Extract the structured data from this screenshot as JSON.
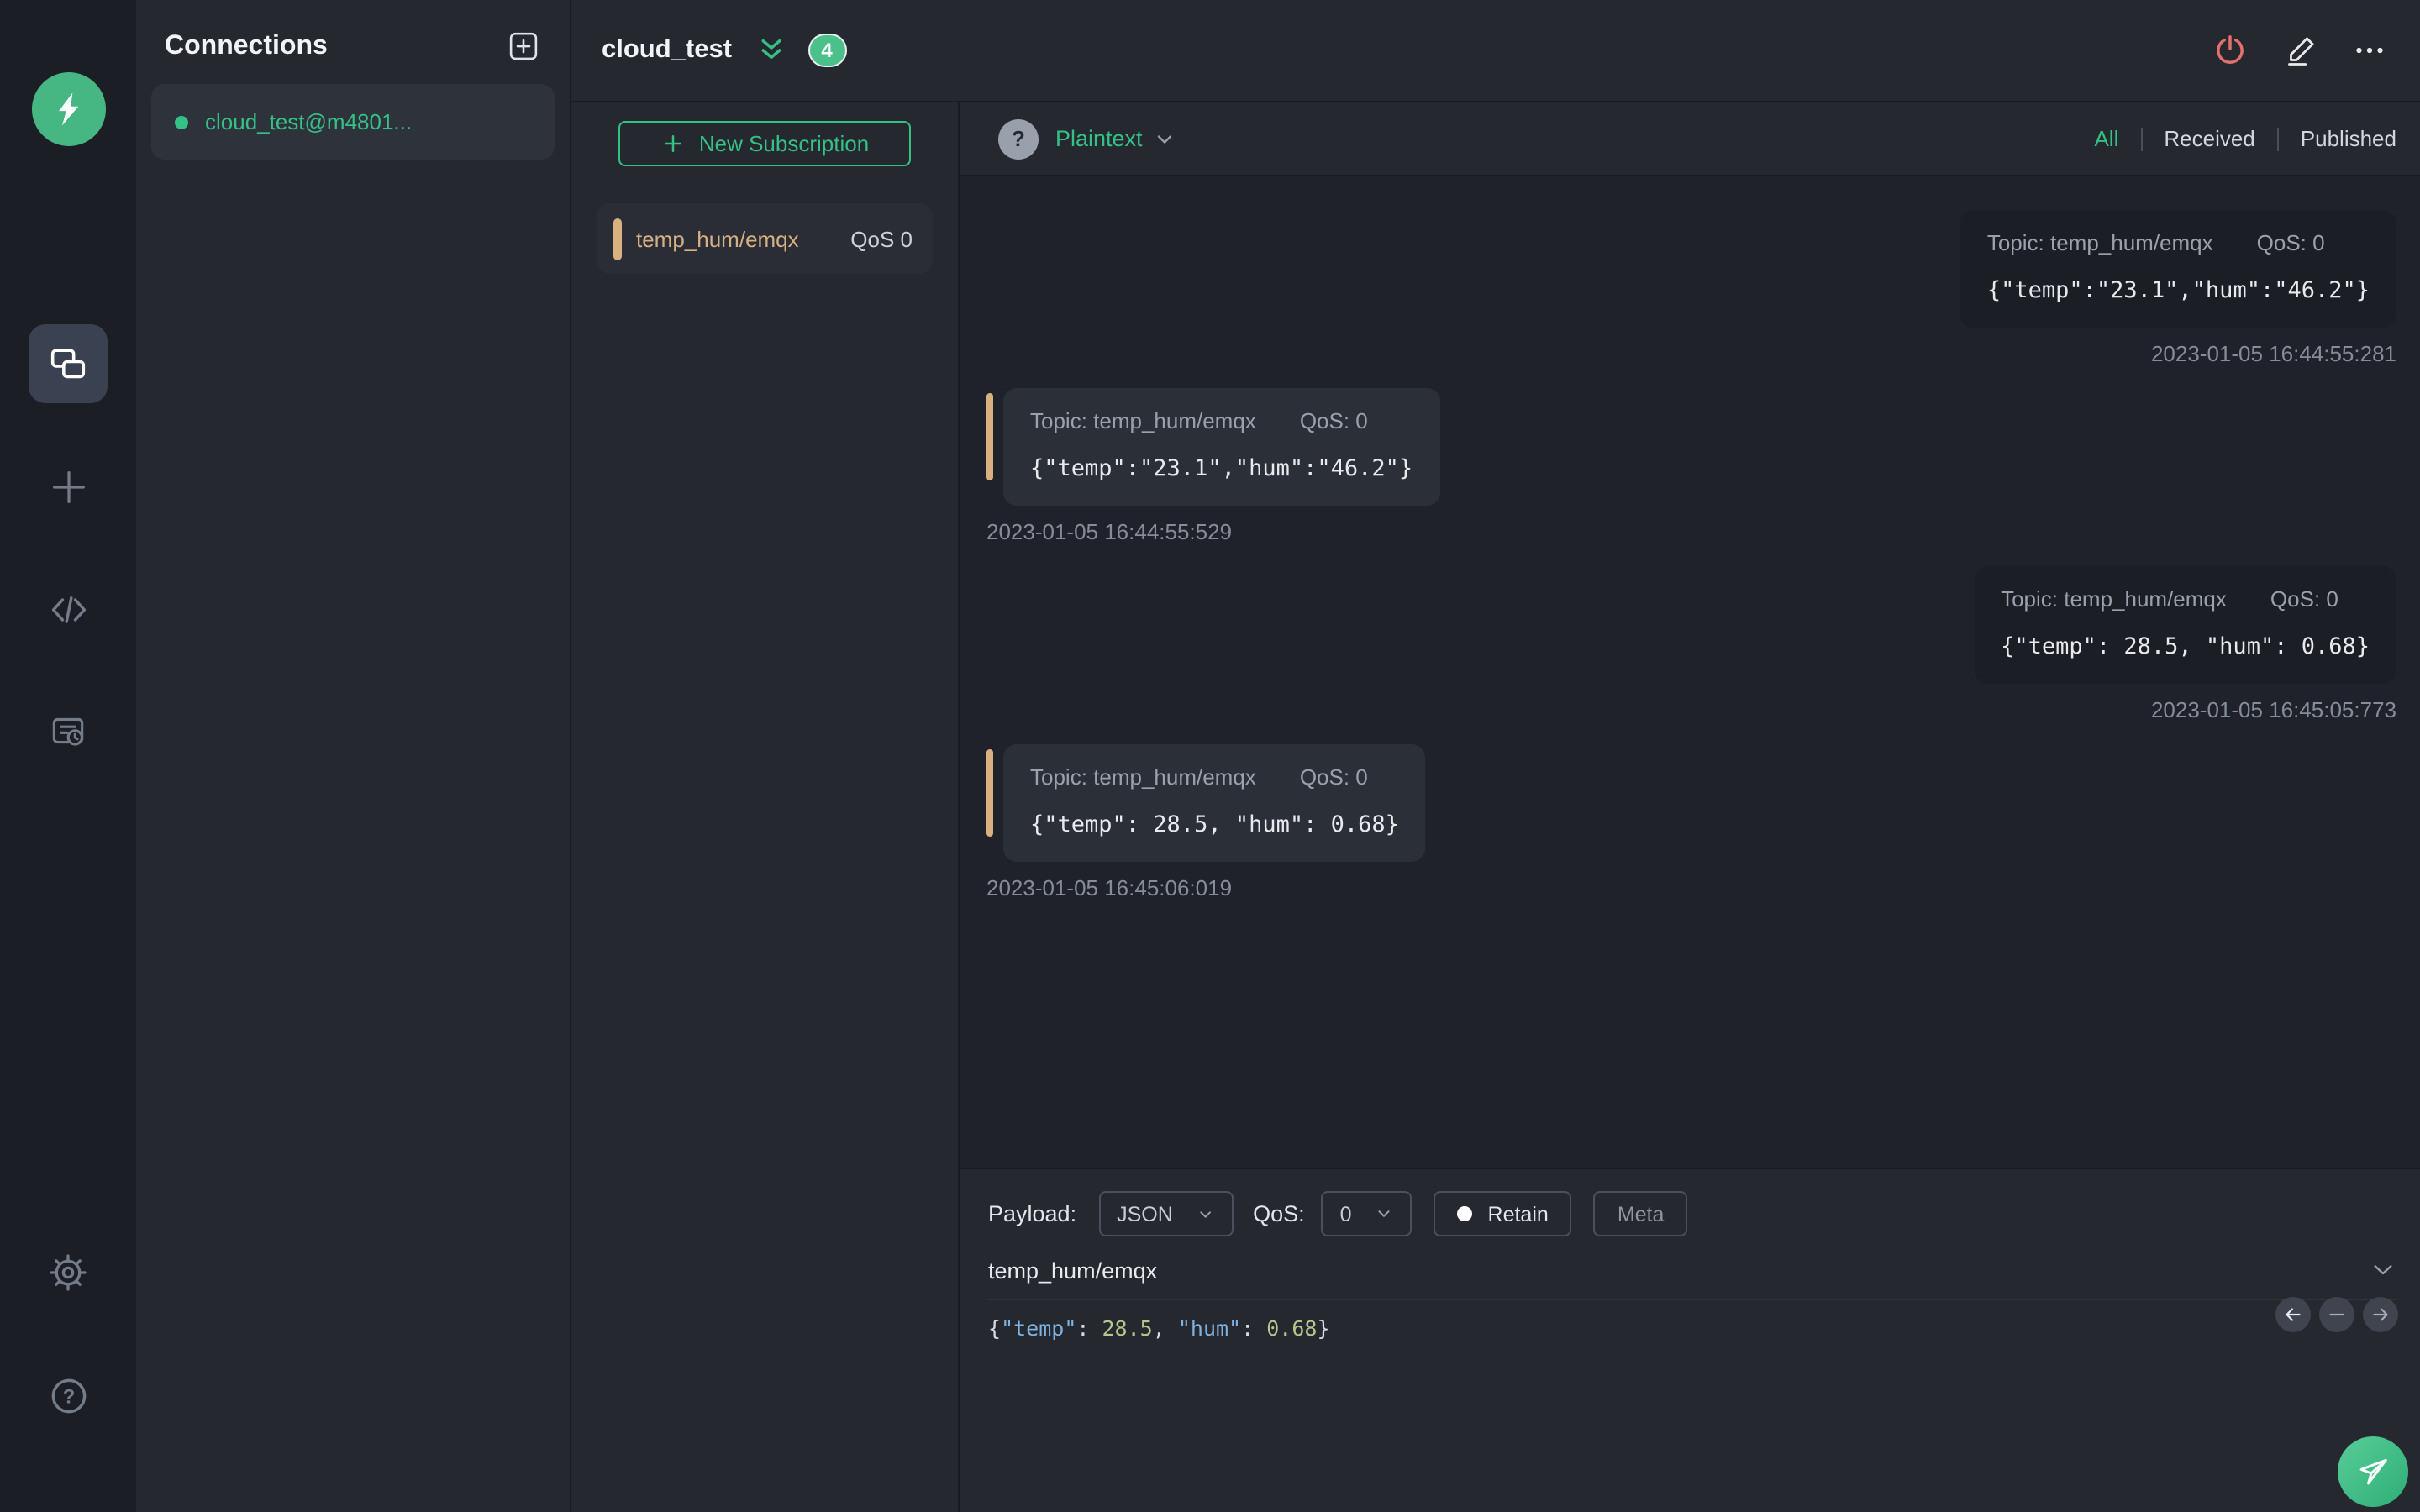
{
  "colors": {
    "accent": "#35c085",
    "topic_tan": "#d5b083",
    "power_red": "#e4706b"
  },
  "rail_icons": [
    "mqttx-logo",
    "connections-icon",
    "new-connection-icon",
    "script-icon",
    "log-icon",
    "settings-icon",
    "help-icon"
  ],
  "connections_panel": {
    "title": "Connections",
    "items": [
      {
        "label": "cloud_test@m4801...",
        "status": "connected"
      }
    ]
  },
  "connection_header": {
    "title": "cloud_test",
    "badge_count": "4",
    "action_icons": [
      "power-icon",
      "edit-icon",
      "more-icon"
    ]
  },
  "subscription_panel": {
    "new_subscription_label": "New Subscription",
    "items": [
      {
        "topic": "temp_hum/emqx",
        "qos": "QoS 0"
      }
    ]
  },
  "message_toolbar": {
    "format": "Plaintext",
    "filters": [
      "All",
      "Received",
      "Published"
    ],
    "active_filter": "All"
  },
  "messages": [
    {
      "direction": "published",
      "topic": "Topic: temp_hum/emqx",
      "qos": "QoS: 0",
      "payload": "{\"temp\":\"23.1\",\"hum\":\"46.2\"}",
      "time": "2023-01-05 16:44:55:281"
    },
    {
      "direction": "received",
      "topic": "Topic: temp_hum/emqx",
      "qos": "QoS: 0",
      "payload": "{\"temp\":\"23.1\",\"hum\":\"46.2\"}",
      "time": "2023-01-05 16:44:55:529"
    },
    {
      "direction": "published",
      "topic": "Topic: temp_hum/emqx",
      "qos": "QoS: 0",
      "payload": "{\"temp\": 28.5, \"hum\": 0.68}",
      "time": "2023-01-05 16:45:05:773"
    },
    {
      "direction": "received",
      "topic": "Topic: temp_hum/emqx",
      "qos": "QoS: 0",
      "payload": "{\"temp\": 28.5, \"hum\": 0.68}",
      "time": "2023-01-05 16:45:06:019"
    }
  ],
  "composer": {
    "payload_label": "Payload:",
    "payload_format": "JSON",
    "qos_label": "QoS:",
    "qos_value": "0",
    "retain_label": "Retain",
    "meta_label": "Meta",
    "topic": "temp_hum/emqx",
    "payload_tokens": {
      "open": "{",
      "key1": "\"temp\"",
      "colon1": ": ",
      "num1": "28.5",
      "comma": ", ",
      "key2": "\"hum\"",
      "colon2": ": ",
      "num2": "0.68",
      "close": "}"
    }
  }
}
